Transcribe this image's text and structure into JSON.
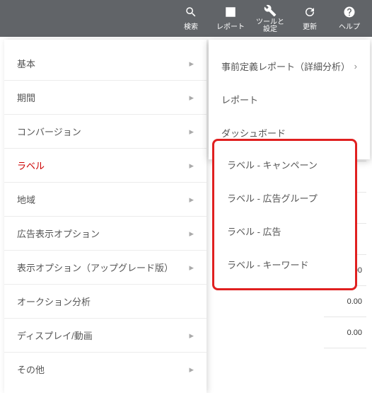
{
  "toolbar": [
    {
      "name": "search",
      "label": "検索"
    },
    {
      "name": "reports",
      "label": "レポート"
    },
    {
      "name": "tools",
      "label": "ツールと\n設定"
    },
    {
      "name": "refresh",
      "label": "更新"
    },
    {
      "name": "help",
      "label": "ヘルプ"
    }
  ],
  "popover": {
    "items": [
      {
        "label": "事前定義レポート（詳細分析）",
        "has_sub": true
      },
      {
        "label": "レポート",
        "has_sub": false
      },
      {
        "label": "ダッシュボード",
        "has_sub": false
      }
    ]
  },
  "left_menu": {
    "items": [
      {
        "label": "基本",
        "arrow": true
      },
      {
        "label": "期間",
        "arrow": true
      },
      {
        "label": "コンバージョン",
        "arrow": true
      },
      {
        "label": "ラベル",
        "arrow": true,
        "selected": true
      },
      {
        "label": "地域",
        "arrow": true
      },
      {
        "label": "広告表示オプション",
        "arrow": true
      },
      {
        "label": "表示オプション（アップグレード版）",
        "arrow": true
      },
      {
        "label": "オークション分析",
        "arrow": false
      },
      {
        "label": "ディスプレイ/動画",
        "arrow": true
      },
      {
        "label": "その他",
        "arrow": true
      }
    ]
  },
  "submenu": {
    "items": [
      "ラベル - キャンペーン",
      "ラベル - 広告グループ",
      "ラベル - 広告",
      "ラベル - キーワード"
    ]
  },
  "data_values": [
    "",
    "",
    "",
    "",
    "",
    "",
    "",
    "0.00",
    "0.00",
    "0.00"
  ]
}
